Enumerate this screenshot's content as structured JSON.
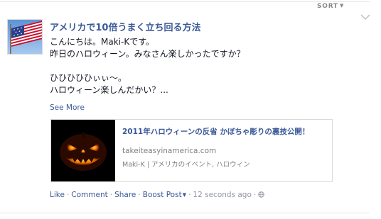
{
  "header": {
    "sort_label": "SORT",
    "sort_caret_icon": "caret-down-icon",
    "options_icon": "chevron-down-icon"
  },
  "post": {
    "avatar_icon": "us-flag-avatar",
    "page_name": "アメリカで10倍うまく立ち回る方法",
    "lines": [
      "こんにちは。Maki-Kです。",
      "昨日のハロウィーン。みなさん楽しかったですか？",
      "ひひひひひぃぃ～。",
      "ハロウィーン楽しんだかい？..."
    ],
    "see_more": "See More"
  },
  "link_card": {
    "thumbnail_icon": "jack-o-lantern-image",
    "title": "2011年ハロウィーンの反省 かぼちゃ彫りの裏技公開！",
    "domain": "takeiteasyinamerica.com",
    "description": "Maki-K | アメリカのイベント, ハロウィン"
  },
  "actions": {
    "like": "Like",
    "comment": "Comment",
    "share": "Share",
    "boost": "Boost Post",
    "timestamp": "12 seconds ago",
    "privacy_icon": "globe-icon"
  },
  "colors": {
    "link": "#3b5998",
    "muted": "#9197a3",
    "text": "#141823"
  }
}
